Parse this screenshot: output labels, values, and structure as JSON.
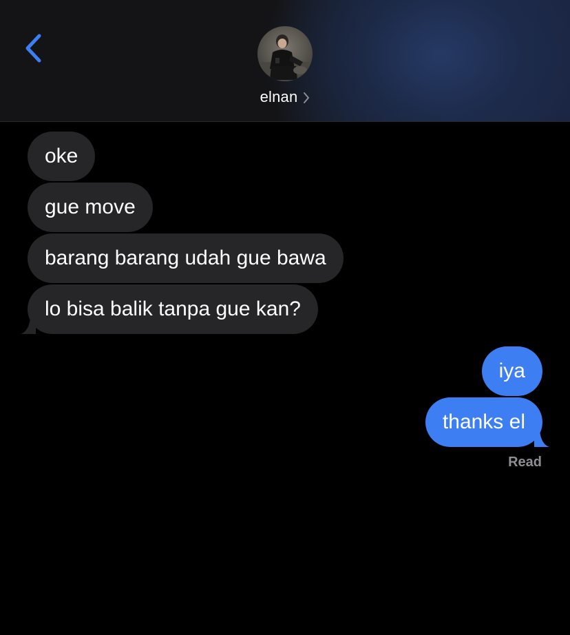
{
  "header": {
    "back_icon": "chevron-left-icon",
    "contact_name": "elnan",
    "contact_chevron_icon": "chevron-right-icon",
    "accent_color": "#3d7ff3"
  },
  "messages": {
    "incoming": [
      {
        "text": "oke"
      },
      {
        "text": "gue move"
      },
      {
        "text": "barang barang udah gue bawa"
      },
      {
        "text": "lo bisa balik tanpa gue kan?"
      }
    ],
    "outgoing": [
      {
        "text": "iya"
      },
      {
        "text": "thanks el"
      }
    ],
    "read_status": "Read"
  },
  "colors": {
    "incoming_bubble": "#262628",
    "outgoing_bubble": "#3d7ff3",
    "background": "#000000"
  }
}
